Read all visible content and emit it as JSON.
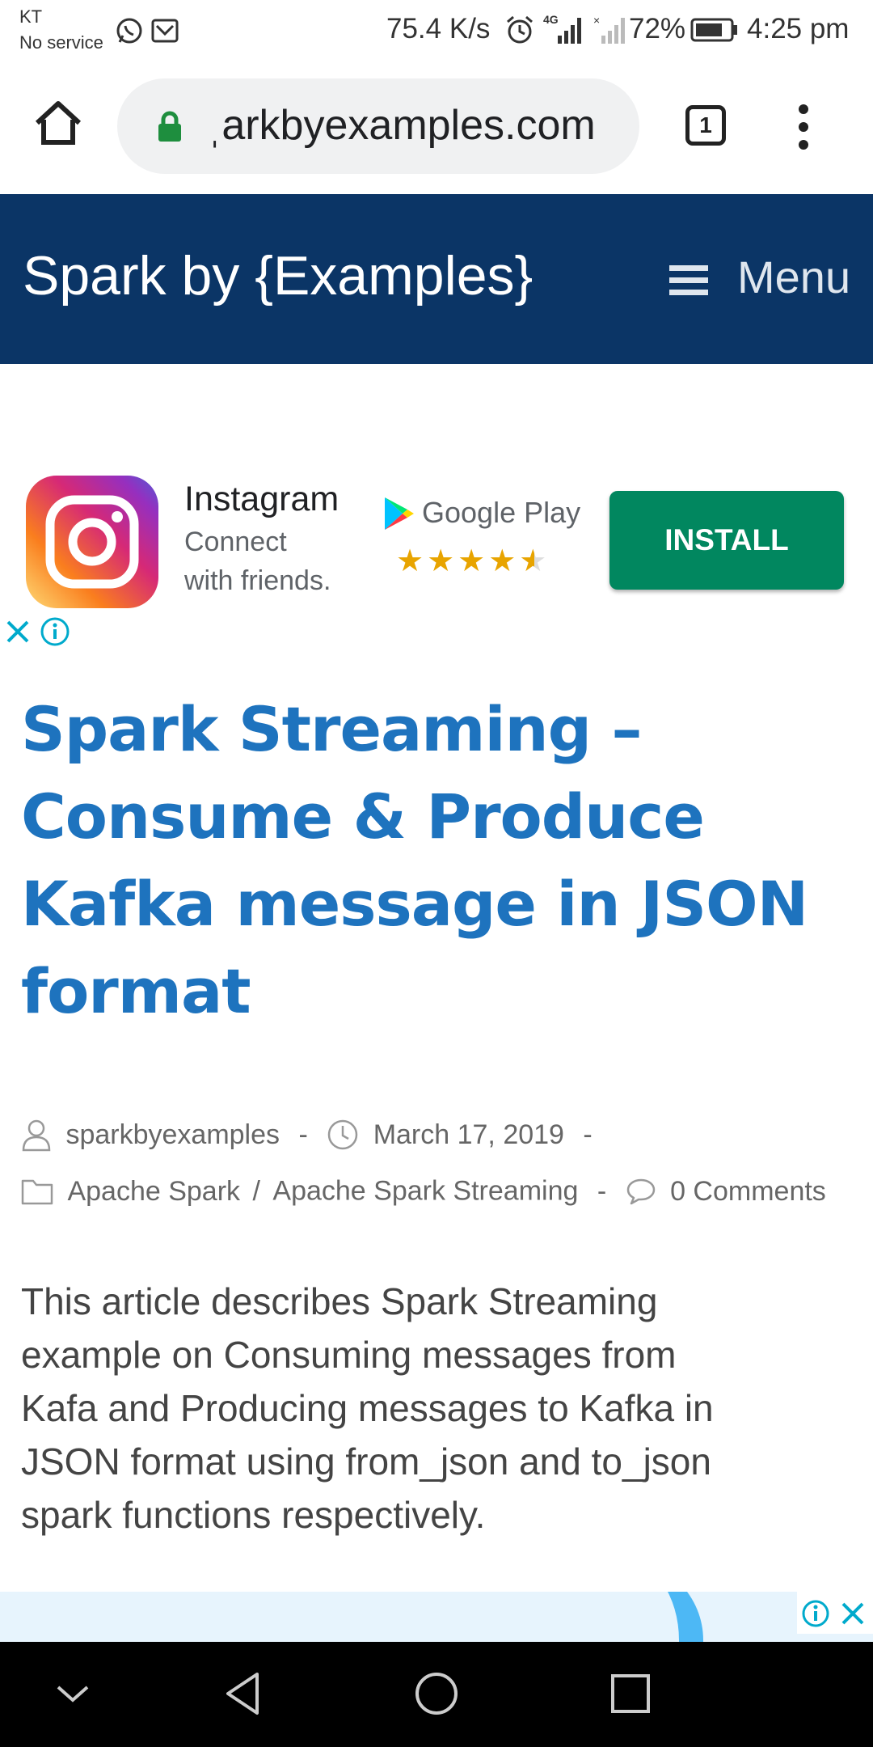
{
  "status_bar": {
    "carrier": "KT",
    "service": "No service",
    "speed": "75.4 K/s",
    "battery_percent": "72%",
    "time": "4:25 pm",
    "network_label": "4G"
  },
  "browser": {
    "url_text": "ˌarkbyexamples.com",
    "tab_count": "1"
  },
  "site": {
    "title": "Spark by {Examples}",
    "menu_label": "Menu"
  },
  "ad": {
    "app_name": "Instagram",
    "line1": "Connect",
    "line2": "with friends.",
    "store_name": "Google Play",
    "rating_stars": 4.5,
    "install_label": "INSTALL"
  },
  "article": {
    "title_lines": [
      "Spark Streaming –",
      "Consume & Produce",
      "Kafka message in JSON",
      "format"
    ],
    "author": "sparkbyexamples",
    "date": "March 17, 2019",
    "category1": "Apache Spark",
    "category_sep": "/",
    "category2": "Apache Spark Streaming",
    "comments": "0 Comments",
    "meta_sep": "-",
    "intro_lines": [
      "This article describes Spark Streaming",
      "example on Consuming messages from",
      "Kafa and Producing messages to Kafka in",
      "JSON format using from_json and to_json",
      "spark functions respectively."
    ]
  },
  "colors": {
    "header_bg": "#0b3566",
    "title_blue": "#1e73be",
    "install_green": "#01875f",
    "star_gold": "#e8a400",
    "ad_accent": "#00aacc"
  }
}
